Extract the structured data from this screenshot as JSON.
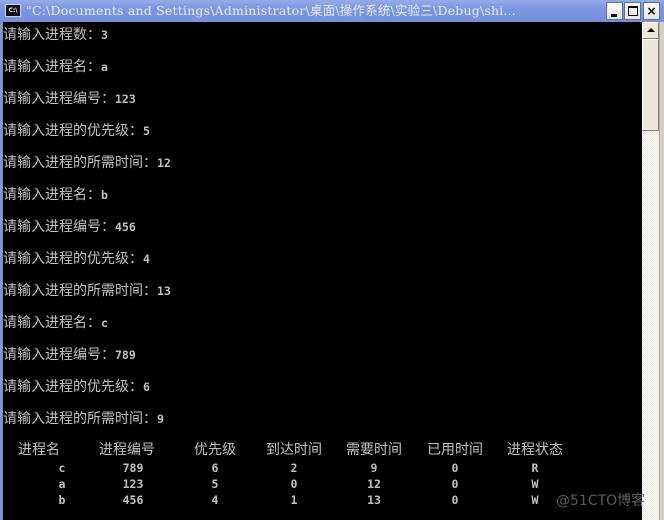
{
  "window": {
    "title": "\"C:\\Documents and Settings\\Administrator\\桌面\\操作系统\\实验三\\Debug\\shi...",
    "icon_label": "C:\\",
    "buttons": {
      "minimize": "minimize",
      "maximize": "maximize",
      "close": "×"
    },
    "state": "inactive"
  },
  "console": {
    "lines": [
      {
        "prompt": "请输入进程数：",
        "value": "3"
      },
      {
        "prompt": "请输入进程名：",
        "value": "a"
      },
      {
        "prompt": "请输入进程编号：",
        "value": "123"
      },
      {
        "prompt": "请输入进程的优先级：",
        "value": "5"
      },
      {
        "prompt": "请输入进程的所需时间：",
        "value": "12"
      },
      {
        "prompt": "请输入进程名：",
        "value": "b"
      },
      {
        "prompt": "请输入进程编号：",
        "value": "456"
      },
      {
        "prompt": "请输入进程的优先级：",
        "value": "4"
      },
      {
        "prompt": "请输入进程的所需时间：",
        "value": "13"
      },
      {
        "prompt": "请输入进程名：",
        "value": "c"
      },
      {
        "prompt": "请输入进程编号：",
        "value": "789"
      },
      {
        "prompt": "请输入进程的优先级：",
        "value": "6"
      },
      {
        "prompt": "请输入进程的所需时间：",
        "value": "9"
      }
    ],
    "table": {
      "headers": [
        "进程名",
        "进程编号",
        "优先级",
        "到达时间",
        "需要时间",
        "已用时间",
        "进程状态"
      ],
      "rows": [
        [
          "c",
          "789",
          "6",
          "2",
          "9",
          "0",
          "R"
        ],
        [
          "a",
          "123",
          "5",
          "0",
          "12",
          "0",
          "W"
        ],
        [
          "b",
          "456",
          "4",
          "1",
          "13",
          "0",
          "W"
        ]
      ]
    }
  },
  "scrollbar": {
    "up_arrow": "scroll-up"
  },
  "watermark": "@51CTO博客",
  "colors": {
    "console_bg": "#000000",
    "console_fg": "#c0c0c0",
    "titlebar": "#7a96df",
    "title_text": "#e6ecfb"
  }
}
